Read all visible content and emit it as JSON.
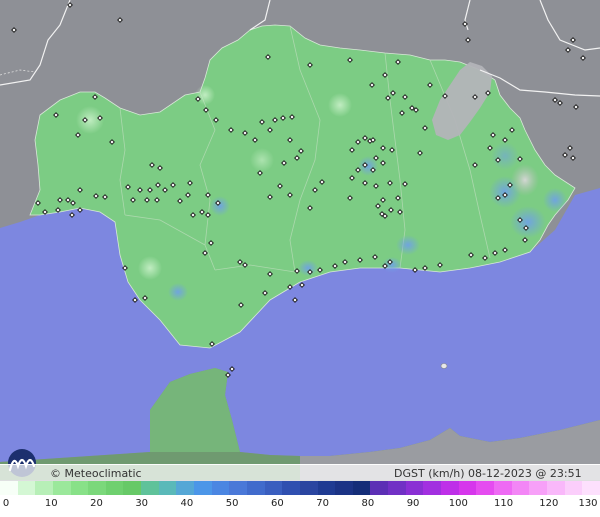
{
  "map": {
    "credit": "© Meteoclimatic",
    "variable": "DGST (km/h)",
    "timestamp": "08-12-2023 @ 23:51 UTC"
  },
  "legend": {
    "ticks": [
      "0",
      "10",
      "20",
      "30",
      "40",
      "50",
      "60",
      "70",
      "80",
      "90",
      "100",
      "110",
      "120",
      "130"
    ],
    "colors": [
      "#f7fff7",
      "#d4f7d4",
      "#b7efb7",
      "#9be89b",
      "#88e188",
      "#7bd87b",
      "#6fd06f",
      "#67c967",
      "#5fc29a",
      "#5ab9b9",
      "#55a7d6",
      "#4c96e8",
      "#4b86e2",
      "#4a78d8",
      "#416bcc",
      "#3a5ebf",
      "#2f4fb0",
      "#2a45a0",
      "#1f3b92",
      "#1b3385",
      "#142d78",
      "#5c2fb5",
      "#7130c5",
      "#8a2fd4",
      "#a22fe0",
      "#be2fe8",
      "#d636ec",
      "#e54cf0",
      "#ee6af4",
      "#f386f6",
      "#f7a0f8",
      "#f9b8fa",
      "#fbcefb",
      "#fde0fd"
    ]
  },
  "stations": [
    [
      14,
      30
    ],
    [
      70,
      5
    ],
    [
      120,
      20
    ],
    [
      268,
      57
    ],
    [
      465,
      24
    ],
    [
      468,
      40
    ],
    [
      573,
      40
    ],
    [
      568,
      50
    ],
    [
      583,
      58
    ],
    [
      310,
      65
    ],
    [
      350,
      60
    ],
    [
      385,
      75
    ],
    [
      398,
      62
    ],
    [
      430,
      85
    ],
    [
      445,
      96
    ],
    [
      475,
      97
    ],
    [
      488,
      93
    ],
    [
      372,
      85
    ],
    [
      95,
      97
    ],
    [
      100,
      118
    ],
    [
      112,
      142
    ],
    [
      85,
      120
    ],
    [
      78,
      135
    ],
    [
      56,
      115
    ],
    [
      198,
      99
    ],
    [
      206,
      110
    ],
    [
      216,
      120
    ],
    [
      231,
      130
    ],
    [
      245,
      133
    ],
    [
      262,
      122
    ],
    [
      275,
      120
    ],
    [
      283,
      118
    ],
    [
      292,
      117
    ],
    [
      270,
      130
    ],
    [
      255,
      140
    ],
    [
      290,
      140
    ],
    [
      301,
      151
    ],
    [
      284,
      163
    ],
    [
      297,
      158
    ],
    [
      260,
      173
    ],
    [
      280,
      186
    ],
    [
      290,
      195
    ],
    [
      270,
      197
    ],
    [
      388,
      98
    ],
    [
      393,
      93
    ],
    [
      405,
      97
    ],
    [
      416,
      110
    ],
    [
      402,
      113
    ],
    [
      412,
      108
    ],
    [
      365,
      138
    ],
    [
      370,
      141
    ],
    [
      358,
      142
    ],
    [
      352,
      150
    ],
    [
      373,
      140
    ],
    [
      383,
      148
    ],
    [
      392,
      150
    ],
    [
      376,
      158
    ],
    [
      383,
      163
    ],
    [
      358,
      170
    ],
    [
      365,
      165
    ],
    [
      373,
      170
    ],
    [
      352,
      178
    ],
    [
      365,
      183
    ],
    [
      376,
      186
    ],
    [
      390,
      183
    ],
    [
      405,
      184
    ],
    [
      398,
      198
    ],
    [
      383,
      200
    ],
    [
      391,
      210
    ],
    [
      385,
      216
    ],
    [
      400,
      212
    ],
    [
      382,
      214
    ],
    [
      378,
      206
    ],
    [
      350,
      198
    ],
    [
      315,
      190
    ],
    [
      322,
      182
    ],
    [
      310,
      208
    ],
    [
      425,
      128
    ],
    [
      420,
      153
    ],
    [
      493,
      135
    ],
    [
      505,
      140
    ],
    [
      512,
      130
    ],
    [
      490,
      148
    ],
    [
      498,
      160
    ],
    [
      475,
      165
    ],
    [
      520,
      159
    ],
    [
      570,
      148
    ],
    [
      573,
      158
    ],
    [
      565,
      155
    ],
    [
      555,
      100
    ],
    [
      560,
      103
    ],
    [
      576,
      107
    ],
    [
      510,
      185
    ],
    [
      505,
      195
    ],
    [
      498,
      198
    ],
    [
      520,
      220
    ],
    [
      526,
      228
    ],
    [
      525,
      240
    ],
    [
      505,
      250
    ],
    [
      495,
      253
    ],
    [
      485,
      258
    ],
    [
      471,
      255
    ],
    [
      440,
      265
    ],
    [
      425,
      268
    ],
    [
      415,
      270
    ],
    [
      390,
      262
    ],
    [
      385,
      266
    ],
    [
      375,
      257
    ],
    [
      360,
      260
    ],
    [
      345,
      262
    ],
    [
      335,
      266
    ],
    [
      320,
      270
    ],
    [
      310,
      272
    ],
    [
      297,
      271
    ],
    [
      302,
      285
    ],
    [
      295,
      300
    ],
    [
      290,
      287
    ],
    [
      270,
      274
    ],
    [
      265,
      293
    ],
    [
      241,
      305
    ],
    [
      245,
      265
    ],
    [
      240,
      262
    ],
    [
      211,
      243
    ],
    [
      205,
      253
    ],
    [
      193,
      215
    ],
    [
      208,
      215
    ],
    [
      218,
      203
    ],
    [
      208,
      195
    ],
    [
      202,
      212
    ],
    [
      180,
      201
    ],
    [
      188,
      195
    ],
    [
      173,
      185
    ],
    [
      165,
      190
    ],
    [
      158,
      185
    ],
    [
      150,
      190
    ],
    [
      140,
      190
    ],
    [
      133,
      200
    ],
    [
      147,
      200
    ],
    [
      157,
      200
    ],
    [
      128,
      187
    ],
    [
      105,
      197
    ],
    [
      96,
      196
    ],
    [
      80,
      190
    ],
    [
      73,
      203
    ],
    [
      68,
      200
    ],
    [
      80,
      210
    ],
    [
      72,
      215
    ],
    [
      60,
      200
    ],
    [
      45,
      212
    ],
    [
      38,
      203
    ],
    [
      58,
      210
    ],
    [
      160,
      168
    ],
    [
      152,
      165
    ],
    [
      190,
      183
    ],
    [
      135,
      300
    ],
    [
      145,
      298
    ],
    [
      125,
      268
    ],
    [
      212,
      344
    ],
    [
      232,
      369
    ],
    [
      228,
      375
    ]
  ]
}
